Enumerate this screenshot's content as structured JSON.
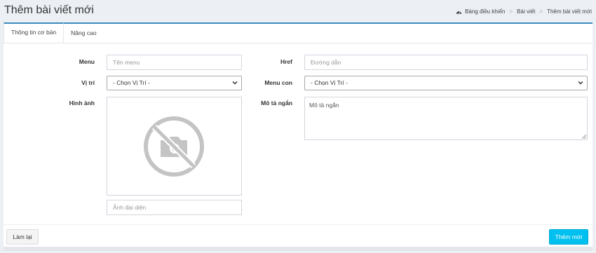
{
  "header": {
    "title": "Thêm bài viết mới",
    "breadcrumb": {
      "home": "Bảng điều khiển",
      "section": "Bài viết",
      "current": "Thêm bài viết mới",
      "home_icon": "dashboard-icon"
    }
  },
  "tabs": [
    {
      "label": "Thông tin cơ bản",
      "active": true
    },
    {
      "label": "Nâng cao",
      "active": false
    }
  ],
  "form": {
    "menu_label": "Menu",
    "menu_placeholder": "Tên menu",
    "href_label": "Href",
    "href_placeholder": "Đường dẫn",
    "position_label": "Vị trí",
    "position_selected": "- Chọn Vị Trí -",
    "submenu_label": "Menu con",
    "submenu_selected": "- Chọn Vị Trí -",
    "image_label": "Hình ảnh",
    "image_icon": "no-image-camera-icon",
    "alt_placeholder": "Ảnh đại diện",
    "desc_label": "Mô tả ngắn",
    "desc_placeholder": "Mô tả ngắn"
  },
  "buttons": {
    "reset": "Làm lại",
    "submit": "Thêm mới"
  },
  "colors": {
    "accent": "#3c8dbc",
    "submit_bg": "#00c0ef",
    "page_bg": "#ecf0f5"
  }
}
